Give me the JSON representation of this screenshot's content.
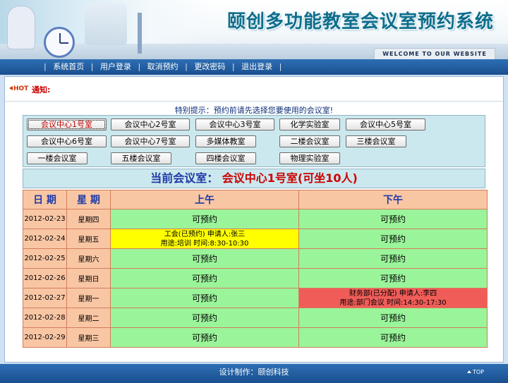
{
  "header": {
    "title": "颐创多功能教室会议室预约系统",
    "welcome": "WELCOME TO OUR WEBSITE"
  },
  "nav": {
    "items": [
      "系统首页",
      "用户登录",
      "取消预约",
      "更改密码",
      "退出登录"
    ]
  },
  "notice": {
    "hot_label": "HOT",
    "label": "通知:"
  },
  "tip": "特别提示：预约前请先选择您要使用的会议室!",
  "rooms": [
    "会议中心1号室",
    "会议中心2号室",
    "会议中心3号室",
    "化学实验室",
    "会议中心5号室",
    "会议中心6号室",
    "会议中心7号室",
    "多媒体教室",
    "二楼会议室",
    "三楼会议室",
    "一楼会议室",
    "五楼会议室",
    "四楼会议室",
    "物理实验室"
  ],
  "current": {
    "label": "当前会议室：",
    "name": "会议中心1号室(可坐10人)"
  },
  "schedule": {
    "headers": {
      "date": "日 期",
      "week": "星 期",
      "am": "上午",
      "pm": "下午"
    },
    "rows": [
      {
        "date": "2012-02-23",
        "week": "星期四",
        "am": "可预约",
        "pm": "可预约"
      },
      {
        "date": "2012-02-24",
        "week": "星期五",
        "am": "工会(已预约) 申请人:张三",
        "am2": "用途:培训 时间:8:30-10:30",
        "pm": "可预约"
      },
      {
        "date": "2012-02-25",
        "week": "星期六",
        "am": "可预约",
        "pm": "可预约"
      },
      {
        "date": "2012-02-26",
        "week": "星期日",
        "am": "可预约",
        "pm": "可预约"
      },
      {
        "date": "2012-02-27",
        "week": "星期一",
        "am": "可预约",
        "pm": "财务部(已分配) 申请人:李四",
        "pm2": "用途:部门会议 时间:14:30-17:30"
      },
      {
        "date": "2012-02-28",
        "week": "星期二",
        "am": "可预约",
        "pm": "可预约"
      },
      {
        "date": "2012-02-29",
        "week": "星期三",
        "am": "可预约",
        "pm": "可预约"
      }
    ]
  },
  "footer": {
    "credit": "设计制作：颐创科技",
    "top": "TOP"
  },
  "colors": {
    "available": "#9af49a",
    "booked": "#ffff00",
    "assigned": "#f05d59",
    "header_cell": "#f9c6a4",
    "nav_bar": "#2d6fb4"
  }
}
